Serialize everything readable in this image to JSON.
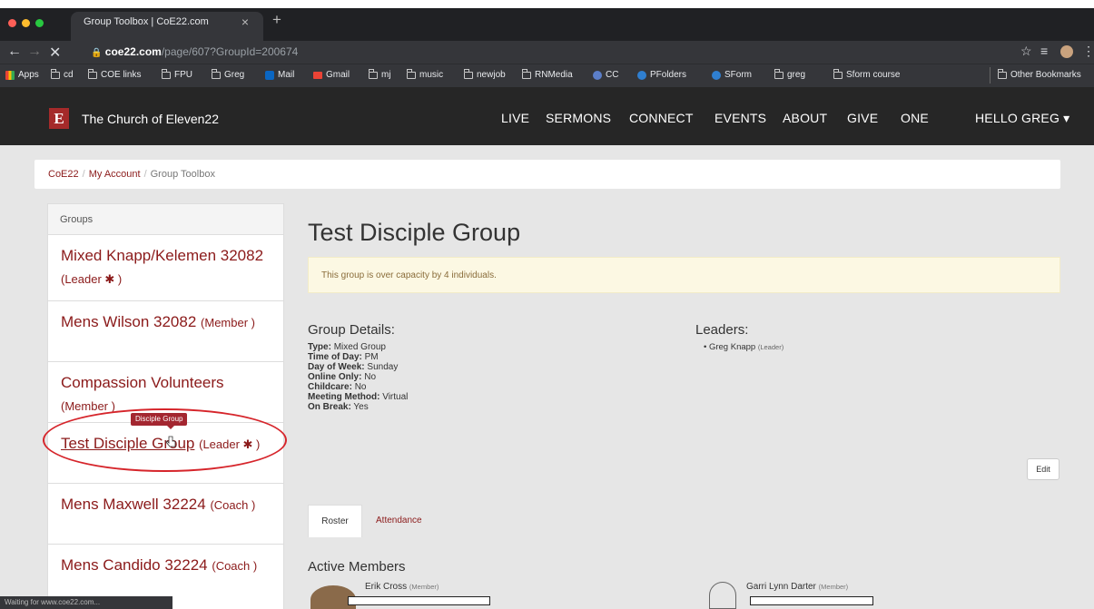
{
  "browser": {
    "tab_title": "Group Toolbox | CoE22.com",
    "url_host": "coe22.com",
    "url_path": "/page/607?GroupId=200674",
    "bookmarks": [
      "Apps",
      "cd",
      "COE links",
      "FPU",
      "Greg",
      "Mail",
      "Gmail",
      "mj",
      "music",
      "newjob",
      "RNMedia",
      "CC",
      "PFolders",
      "SForm",
      "greg",
      "Sform course"
    ],
    "other_bookmarks": "Other Bookmarks",
    "status_text": "Waiting for www.coe22.com..."
  },
  "site": {
    "logo_letter": "E",
    "name": "The Church of Eleven22",
    "nav": [
      "LIVE",
      "SERMONS",
      "CONNECT",
      "EVENTS",
      "ABOUT",
      "GIVE",
      "ONE"
    ],
    "user_menu": "HELLO GREG ▾"
  },
  "breadcrumb": {
    "home": "CoE22",
    "account": "My Account",
    "current": "Group Toolbox"
  },
  "sidebar": {
    "header": "Groups",
    "items": [
      {
        "name": "Mixed Knapp/Kelemen 32082",
        "role": "(Leader ✱ )"
      },
      {
        "name": "Mens Wilson 32082",
        "role": "(Member )"
      },
      {
        "name": "Compassion Volunteers",
        "role": "(Member )"
      },
      {
        "name": "Test Disciple Group",
        "role": "(Leader ✱ )"
      },
      {
        "name": "Mens Maxwell 32224",
        "role": "(Coach )"
      },
      {
        "name": "Mens Candido 32224",
        "role": "(Coach )"
      }
    ],
    "tooltip": "Disciple Group"
  },
  "main": {
    "title": "Test Disciple Group",
    "alert": "This group is over capacity by 4 individuals.",
    "details_title": "Group Details:",
    "details": [
      {
        "label": "Type:",
        "value": "Mixed Group"
      },
      {
        "label": "Time of Day:",
        "value": "PM"
      },
      {
        "label": "Day of Week:",
        "value": "Sunday"
      },
      {
        "label": "Online Only:",
        "value": "No"
      },
      {
        "label": "Childcare:",
        "value": "No"
      },
      {
        "label": "Meeting Method:",
        "value": "Virtual"
      },
      {
        "label": "On Break:",
        "value": "Yes"
      }
    ],
    "leaders_title": "Leaders:",
    "leader_name": "Greg Knapp",
    "leader_role": "(Leader)",
    "edit_label": "Edit",
    "tabs": {
      "roster": "Roster",
      "attendance": "Attendance"
    },
    "active_members_title": "Active Members",
    "members": [
      {
        "name": "Erik Cross",
        "role": "(Member)"
      },
      {
        "name": "Garri Lynn Darter",
        "role": "(Member)"
      }
    ]
  },
  "colors": {
    "brand": "#a52a2a",
    "link": "#8b1a1a",
    "nav_bg": "#262626",
    "annotation": "#d6252b"
  }
}
